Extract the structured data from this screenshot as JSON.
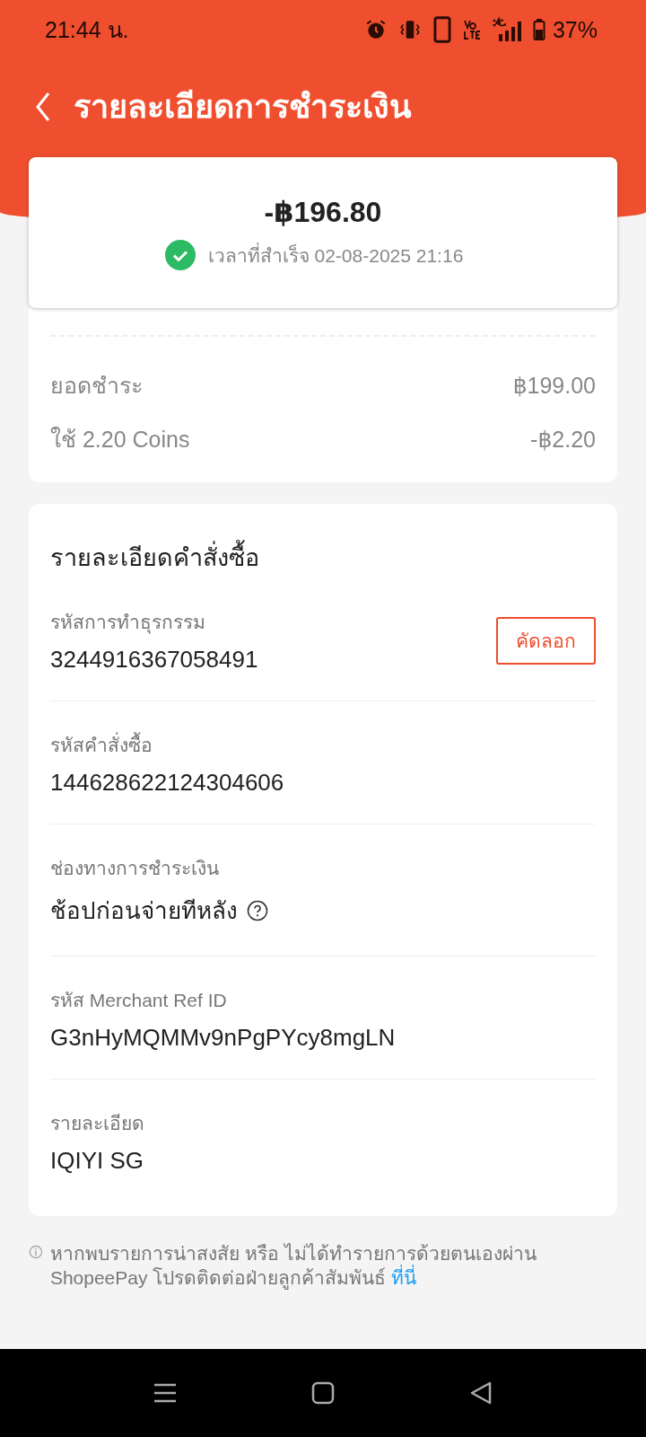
{
  "status_bar": {
    "time": "21:44 น.",
    "battery": "37%"
  },
  "header": {
    "title": "รายละเอียดการชำระเงิน"
  },
  "summary": {
    "amount": "-฿196.80",
    "status": "เวลาที่สำเร็จ 02-08-2025 21:16"
  },
  "breakdown": [
    {
      "label": "ยอดชำระ",
      "value": "฿199.00"
    },
    {
      "label": "ใช้ 2.20 Coins",
      "value": "-฿2.20"
    }
  ],
  "order": {
    "title": "รายละเอียดคำสั่งซื้อ",
    "fields": [
      {
        "label": "รหัสการทำธุรกรรม",
        "value": "3244916367058491",
        "action": "คัดลอก",
        "help": false
      },
      {
        "label": "รหัสคำสั่งซื้อ",
        "value": "144628622124304606",
        "help": false
      },
      {
        "label": "ช่องทางการชำระเงิน",
        "value": "ช้อปก่อนจ่ายทีหลัง",
        "help": true
      },
      {
        "label": "รหัส Merchant Ref ID",
        "value": "G3nHyMQMMv9nPgPYcy8mgLN",
        "help": false
      },
      {
        "label": "รายละเอียด",
        "value": "IQIYI SG",
        "help": false
      }
    ]
  },
  "note": {
    "text": "หากพบรายการน่าสงสัย หรือ ไม่ได้ทำรายการด้วยตนเองผ่าน ShopeePay โปรดติดต่อฝ่ายลูกค้าสัมพันธ์",
    "link": "ที่นี่"
  }
}
